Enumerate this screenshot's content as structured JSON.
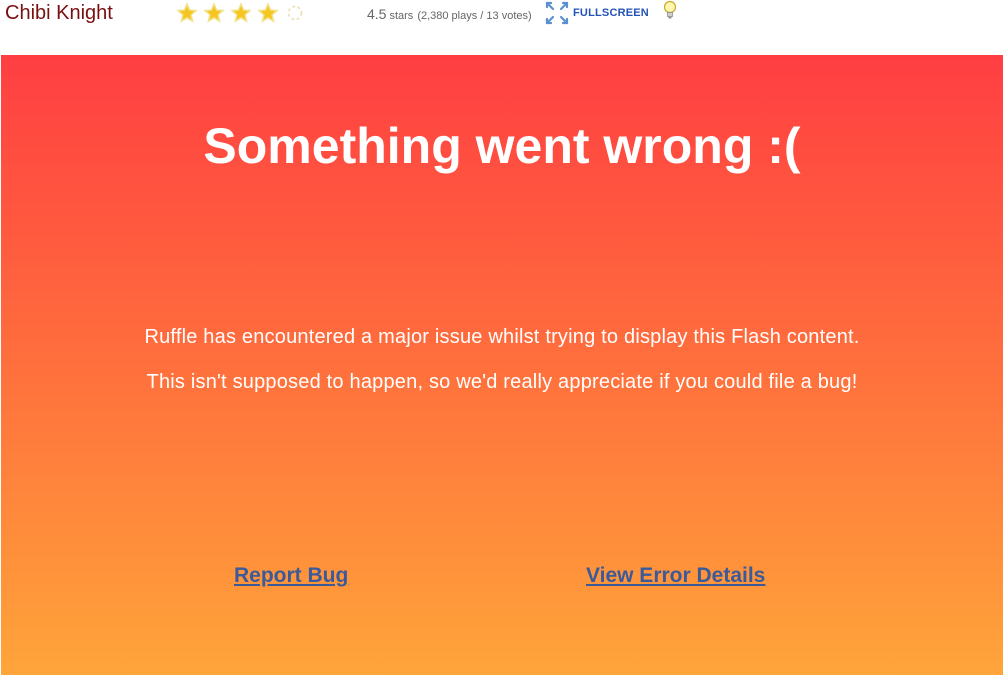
{
  "header": {
    "game_title": "Chibi Knight",
    "rating": {
      "value": 4.5,
      "value_text": "4.5",
      "unit_text": "stars",
      "meta_text": "(2,380 plays / 13 votes)",
      "stars_filled": 4,
      "stars_total": 5
    },
    "fullscreen_label": "FULLSCREEN",
    "icons": {
      "fullscreen": "fullscreen-arrows-icon",
      "lights": "lightbulb-icon",
      "star": "star-icon"
    }
  },
  "error_panel": {
    "heading": "Something went wrong :(",
    "message_line_1": "Ruffle has encountered a major issue whilst trying to display this Flash content.",
    "message_line_2": "This isn't supposed to happen, so we'd really appreciate if you could file a bug!",
    "report_bug_label": "Report Bug",
    "view_error_details_label": "View Error Details",
    "colors": {
      "gradient_top": "#ff3e42",
      "gradient_bottom": "#ffa53a",
      "link": "#3b5a9a"
    }
  }
}
